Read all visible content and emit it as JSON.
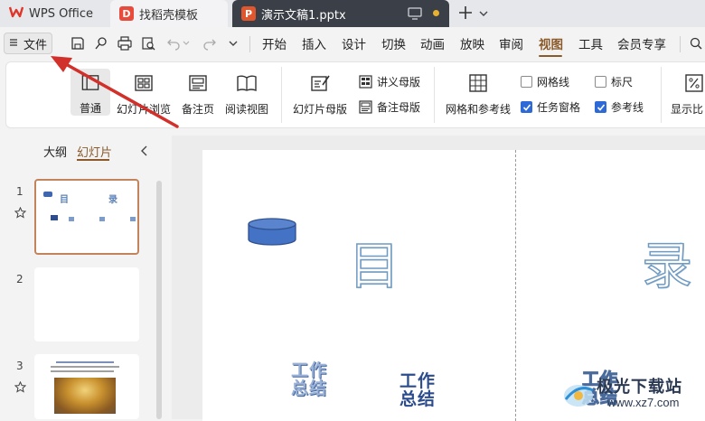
{
  "tabs": [
    {
      "label": "WPS Office",
      "icon": "wps-logo-icon"
    },
    {
      "label": "找稻壳模板",
      "icon": "docer-icon"
    },
    {
      "label": "演示文稿1.pptx",
      "icon": "ppt-icon"
    }
  ],
  "menu": {
    "file_label": "文件",
    "items": [
      "开始",
      "插入",
      "设计",
      "切换",
      "动画",
      "放映",
      "审阅",
      "视图",
      "工具",
      "会员专享"
    ],
    "active": "视图"
  },
  "ribbon": {
    "normal": "普通",
    "slide_browse": "幻灯片浏览",
    "notes_page": "备注页",
    "reading_view": "阅读视图",
    "slide_master": "幻灯片母版",
    "handout_master": "讲义母版",
    "notes_master": "备注母版",
    "grid_guides": "网格和参考线",
    "gridlines": "网格线",
    "ruler": "标尺",
    "task_pane": "任务窗格",
    "guides": "参考线",
    "display_ratio": "显示比",
    "checkbox_states": {
      "gridlines": false,
      "ruler": false,
      "task_pane": true,
      "guides": true
    }
  },
  "left_panel": {
    "outline_tab": "大纲",
    "slides_tab": "幻灯片",
    "slide_numbers": [
      "1",
      "2",
      "3"
    ]
  },
  "slide": {
    "char_mu": "目",
    "char_lu": "录",
    "wordart_1": "工作总结",
    "wordart_2": "工作总结",
    "wordart_3": "工作总结"
  },
  "thumbnail_1": {
    "mu": "目",
    "lu": "录"
  },
  "watermark": "极光下载站",
  "watermark_url": "www.xz7.com",
  "colors": {
    "accent": "#8a5a2a",
    "active_tab_bg": "#3b3f47",
    "checkbox": "#2d6ad8",
    "arrow": "#d2302b"
  }
}
